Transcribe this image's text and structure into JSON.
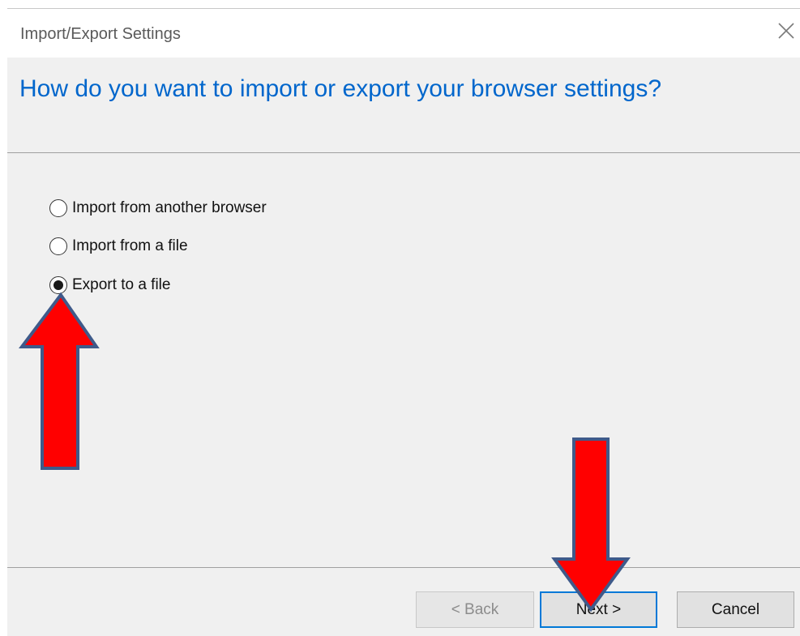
{
  "window": {
    "title": "Import/Export Settings",
    "close_icon": "close-icon"
  },
  "header": {
    "heading": "How do you want to import or export your browser settings?",
    "heading_color": "#0066cc"
  },
  "options": [
    {
      "label": "Import from another browser",
      "selected": false
    },
    {
      "label": "Import from a file",
      "selected": false
    },
    {
      "label": "Export to a file",
      "selected": true
    }
  ],
  "footer": {
    "back_label": "< Back",
    "back_enabled": false,
    "next_label": "Next >",
    "cancel_label": "Cancel"
  },
  "annotations": {
    "arrow_color": "#ff0000",
    "arrow_outline": "#3f5a8a",
    "arrows": [
      "up-arrow-pointing-at-export-option",
      "down-arrow-pointing-at-next-button"
    ]
  }
}
